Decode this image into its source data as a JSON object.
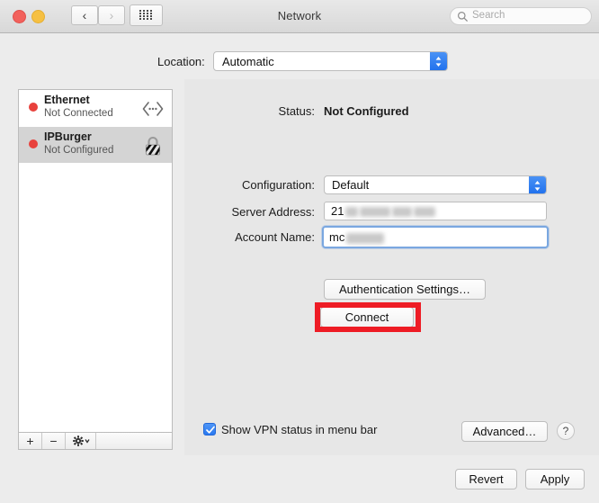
{
  "window": {
    "title": "Network",
    "traffic_lights": [
      {
        "name": "close",
        "color": "#f2615c"
      },
      {
        "name": "minimize",
        "color": "#f6c042"
      }
    ],
    "nav": {
      "back": "‹",
      "forward": "›"
    },
    "search": {
      "placeholder": "Search",
      "value": ""
    }
  },
  "location": {
    "label": "Location:",
    "value": "Automatic"
  },
  "sidebar": {
    "services": [
      {
        "name": "Ethernet",
        "status": "Not Connected",
        "status_color": "#e8413c",
        "icon": "ethernet-icon",
        "selected": false
      },
      {
        "name": "IPBurger",
        "status": "Not Configured",
        "status_color": "#e8413c",
        "icon": "vpn-lock-icon",
        "selected": true
      }
    ],
    "footer": {
      "add": "+",
      "remove": "−",
      "actions": "gear-icon"
    }
  },
  "detail": {
    "status_label": "Status:",
    "status_value": "Not Configured",
    "configuration_label": "Configuration:",
    "configuration_value": "Default",
    "server_label": "Server Address:",
    "server_value": "21",
    "account_label": "Account Name:",
    "account_value": "mc",
    "auth_button": "Authentication Settings…",
    "connect_button": "Connect",
    "vpn_checkbox_label": "Show VPN status in menu bar",
    "vpn_checkbox_checked": true,
    "advanced_button": "Advanced…",
    "help_button": "?"
  },
  "footer": {
    "revert_button": "Revert",
    "apply_button": "Apply"
  },
  "colors": {
    "accent": "#2272ed",
    "highlight_box": "#ee1c25",
    "status_dot": "#e8413c"
  }
}
